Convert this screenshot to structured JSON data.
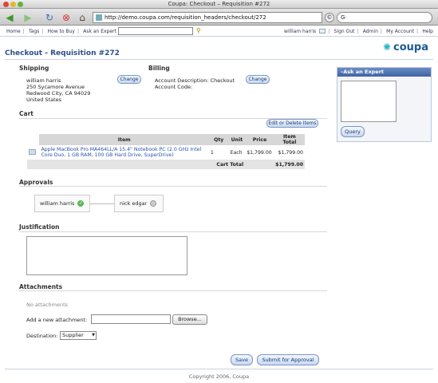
{
  "window": {
    "title": "Coupa: Checkout – Requisition #272"
  },
  "browser": {
    "url": "http://demo.coupa.com/requisition_headers/checkout/272",
    "search_value": "G·"
  },
  "appnav": {
    "links": [
      "Home",
      "Tags",
      "How to Buy",
      "Ask an Expert"
    ],
    "user": "william harris",
    "right_links": [
      "Sign Out",
      "Admin",
      "My Account",
      "Help"
    ]
  },
  "page": {
    "title": "Checkout - Requisition #272",
    "logo": "coupa"
  },
  "shipping": {
    "heading": "Shipping",
    "name": "william harris",
    "street": "250 Sycamore Avenue",
    "city": "Redwood City, CA 94029",
    "country": "United States",
    "change_label": "Change"
  },
  "billing": {
    "heading": "Billing",
    "desc": "Account Description: Checkout",
    "code": "Account Code:",
    "change_label": "Change"
  },
  "cart": {
    "heading": "Cart",
    "edit_label": "Edit or Delete Items",
    "columns": [
      "Item",
      "Qty",
      "Unit",
      "Price",
      "Item Total"
    ],
    "rows": [
      {
        "item": "Apple MacBook Pro MA464LL/A 15.4\" Notebook PC (2.0 GHz Intel Core Duo, 1 GB RAM, 100 GB Hard Drive, SuperDrive)",
        "qty": "1",
        "unit": "Each",
        "price": "$1,799.00",
        "total": "$1,799.00"
      }
    ],
    "total_label": "Cart Total",
    "total_value": "$1,799.00"
  },
  "approvals": {
    "heading": "Approvals",
    "approvers": [
      {
        "name": "william harris",
        "status": "approved"
      },
      {
        "name": "nick edgar",
        "status": "pending"
      }
    ]
  },
  "justification": {
    "heading": "Justification",
    "value": ""
  },
  "attachments": {
    "heading": "Attachments",
    "empty_text": "No attachments",
    "add_label": "Add a new attachment:",
    "browse_label": "Browse...",
    "destination_label": "Destination:",
    "destination_value": "Supplier"
  },
  "actions": {
    "save_label": "Save",
    "submit_label": "Submit for Approval"
  },
  "ask_expert": {
    "heading": "Ask an Expert",
    "query_label": "Query"
  },
  "footer": {
    "copyright": "Copyright 2006, Coupa"
  },
  "colors": {
    "accent": "#2b4f8a",
    "link": "#2955a8",
    "brand_teal": "#2bb3c4"
  }
}
